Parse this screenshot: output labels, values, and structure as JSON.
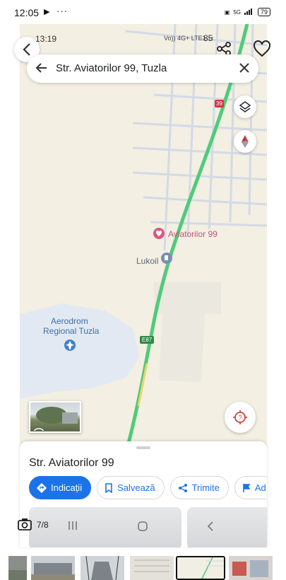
{
  "status_bar": {
    "time": "12:05",
    "play_indicator": "▶",
    "more": "···",
    "network": "5G",
    "battery": "79"
  },
  "inner_status": {
    "time": "13:19",
    "network": "Vo)) 4G+ LTE1 ↓↑",
    "battery": "85"
  },
  "search": {
    "query": "Str. Aviatorilor 99, Tuzla"
  },
  "map": {
    "pin_label": "Aviatorilor 99",
    "station_label": "Lukoil",
    "airport_label_line1": "Aerodrom",
    "airport_label_line2": "Regional Tuzla",
    "road_e87": "E87",
    "road_39": "39",
    "colors": {
      "route": "#4ecb7a",
      "road": "#d4dbe6",
      "airport": "#dfe7f2",
      "land": "#f3efe2",
      "pin": "#d9597f"
    }
  },
  "sheet": {
    "title": "Str. Aviatorilor 99",
    "actions": [
      {
        "label": "Indicații",
        "icon": "directions-icon"
      },
      {
        "label": "Salvează",
        "icon": "bookmark-icon"
      },
      {
        "label": "Trimite",
        "icon": "share-icon"
      },
      {
        "label": "Ad",
        "icon": "flag-icon"
      }
    ]
  },
  "gallery": {
    "counter": "7/8"
  },
  "filmstrip": {
    "count": 6,
    "active_index": 4
  }
}
